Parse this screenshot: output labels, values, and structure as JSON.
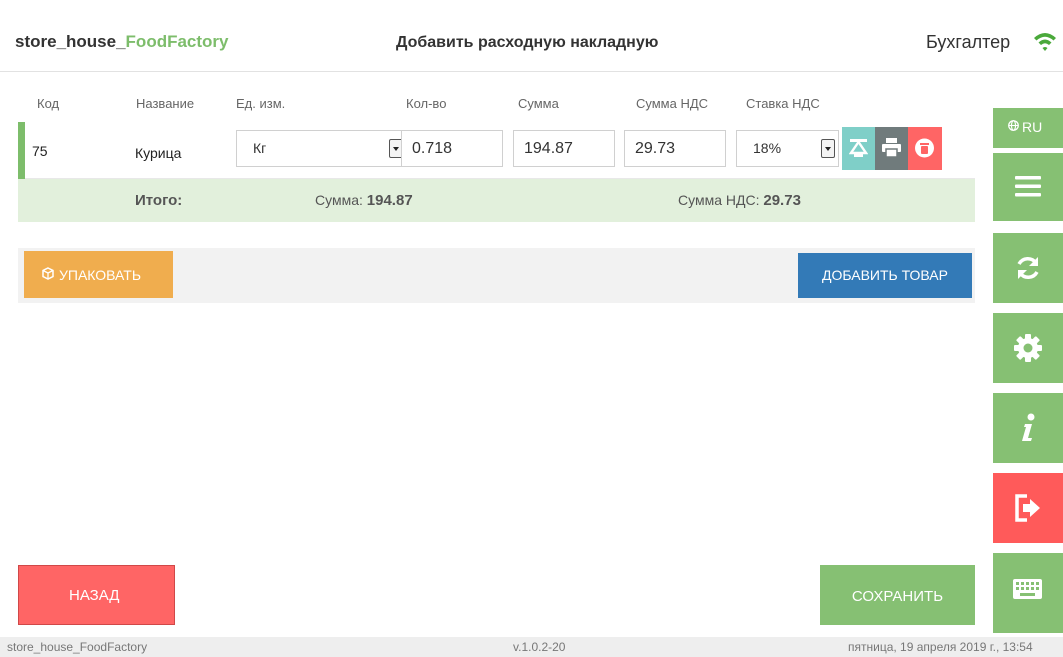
{
  "header": {
    "brand_prefix": "store_house_",
    "brand_accent": "FoodFactory",
    "title": "Добавить расходную накладную",
    "user": "Бухгалтер"
  },
  "columns": {
    "code": "Код",
    "name": "Название",
    "unit": "Ед. изм.",
    "qty": "Кол-во",
    "sum": "Сумма",
    "vat_sum": "Сумма НДС",
    "vat_rate": "Ставка НДС"
  },
  "row": {
    "code": "75",
    "name": "Курица",
    "unit": "Кг",
    "qty": "0.718",
    "sum": "194.87",
    "vat_sum": "29.73",
    "vat_rate": "18%"
  },
  "totals": {
    "label": "Итого:",
    "sum_label": "Сумма:",
    "sum_value": "194.87",
    "vat_label": "Сумма НДС:",
    "vat_value": "29.73"
  },
  "actions": {
    "pack": "УПАКОВАТЬ",
    "add_item": "ДОБАВИТЬ ТОВАР",
    "back": "НАЗАД",
    "save": "СОХРАНИТЬ"
  },
  "sidebar": {
    "lang": "RU",
    "items": [
      "menu-icon",
      "sync-icon",
      "gear-icon",
      "info-icon",
      "logout-icon",
      "keyboard-icon"
    ]
  },
  "status": {
    "app": "store_house_FoodFactory",
    "version": "v.1.0.2-20",
    "datetime": "пятница, 19 апреля 2019 г., 13:54"
  },
  "colors": {
    "green": "#86c073",
    "brand_green": "#7dbd6b",
    "orange": "#f0ad4e",
    "blue": "#337ab7",
    "red": "#ff6565",
    "teal": "#7fcfc8",
    "gray": "#707b7c",
    "totals_bg": "#e2f0dc"
  }
}
